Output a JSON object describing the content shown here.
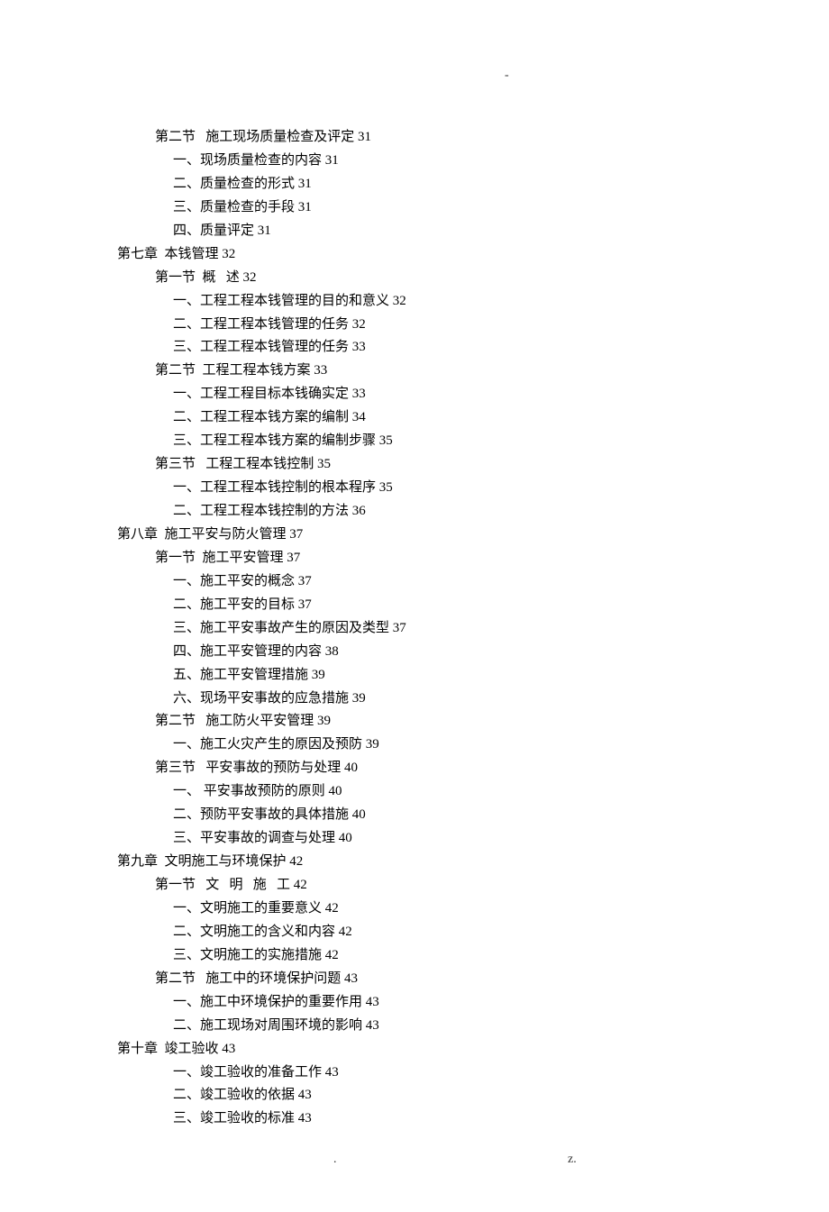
{
  "header_mark": "-",
  "footer_left": ".",
  "footer_right": "z.",
  "toc": [
    {
      "level": "section",
      "text": "第二节   施工现场质量检查及评定 31"
    },
    {
      "level": "item",
      "text": "一、现场质量检查的内容 31"
    },
    {
      "level": "item",
      "text": "二、质量检查的形式 31"
    },
    {
      "level": "item",
      "text": "三、质量检查的手段 31"
    },
    {
      "level": "item",
      "text": "四、质量评定 31"
    },
    {
      "level": "chapter",
      "text": "第七章  本钱管理 32"
    },
    {
      "level": "section",
      "text": "第一节  概   述 32"
    },
    {
      "level": "item",
      "text": "一、工程工程本钱管理的目的和意义 32"
    },
    {
      "level": "item",
      "text": "二、工程工程本钱管理的任务 32"
    },
    {
      "level": "item",
      "text": "三、工程工程本钱管理的任务 33"
    },
    {
      "level": "section",
      "text": "第二节  工程工程本钱方案 33"
    },
    {
      "level": "item",
      "text": "一、工程工程目标本钱确实定 33"
    },
    {
      "level": "item",
      "text": "二、工程工程本钱方案的编制 34"
    },
    {
      "level": "item",
      "text": "三、工程工程本钱方案的编制步骤 35"
    },
    {
      "level": "section",
      "text": "第三节   工程工程本钱控制 35"
    },
    {
      "level": "item",
      "text": "一、工程工程本钱控制的根本程序 35"
    },
    {
      "level": "item",
      "text": "二、工程工程本钱控制的方法 36"
    },
    {
      "level": "chapter",
      "text": "第八章  施工平安与防火管理 37"
    },
    {
      "level": "section",
      "text": "第一节  施工平安管理 37"
    },
    {
      "level": "item",
      "text": "一、施工平安的概念 37"
    },
    {
      "level": "item",
      "text": "二、施工平安的目标 37"
    },
    {
      "level": "item",
      "text": "三、施工平安事故产生的原因及类型 37"
    },
    {
      "level": "item",
      "text": "四、施工平安管理的内容 38"
    },
    {
      "level": "item",
      "text": "五、施工平安管理措施 39"
    },
    {
      "level": "item",
      "text": "六、现场平安事故的应急措施 39"
    },
    {
      "level": "section",
      "text": "第二节   施工防火平安管理 39"
    },
    {
      "level": "item",
      "text": "一、施工火灾产生的原因及预防 39"
    },
    {
      "level": "section",
      "text": "第三节   平安事故的预防与处理 40"
    },
    {
      "level": "item-alt",
      "text": "一、 平安事故预防的原则 40"
    },
    {
      "level": "item",
      "text": "二、预防平安事故的具体措施 40"
    },
    {
      "level": "item",
      "text": "三、平安事故的调查与处理 40"
    },
    {
      "level": "chapter",
      "text": "第九章  文明施工与环境保护 42"
    },
    {
      "level": "section",
      "text": "第一节   文   明   施   工 42"
    },
    {
      "level": "item",
      "text": "一、文明施工的重要意义 42"
    },
    {
      "level": "item",
      "text": "二、文明施工的含义和内容 42"
    },
    {
      "level": "item",
      "text": "三、文明施工的实施措施 42"
    },
    {
      "level": "section",
      "text": "第二节   施工中的环境保护问题 43"
    },
    {
      "level": "item",
      "text": "一、施工中环境保护的重要作用 43"
    },
    {
      "level": "item",
      "text": "二、施工现场对周围环境的影响 43"
    },
    {
      "level": "chapter",
      "text": "第十章  竣工验收 43"
    },
    {
      "level": "item",
      "text": "一、竣工验收的准备工作 43"
    },
    {
      "level": "item",
      "text": "二、竣工验收的依据 43"
    },
    {
      "level": "item",
      "text": "三、竣工验收的标准 43"
    }
  ]
}
